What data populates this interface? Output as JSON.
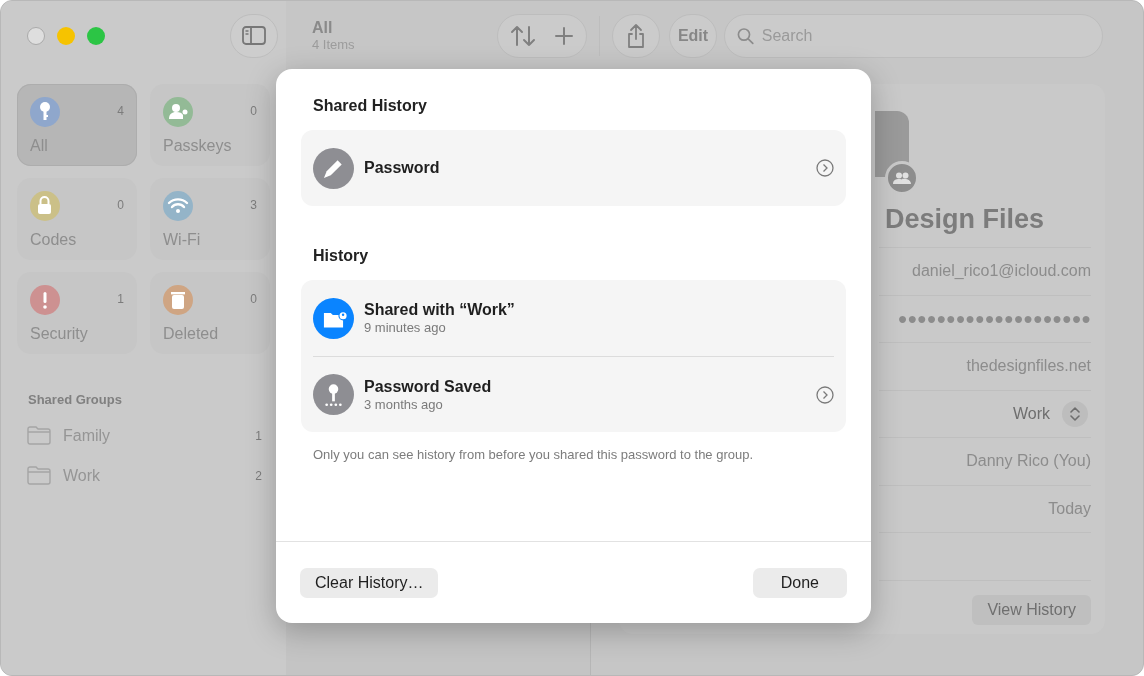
{
  "toolbar": {
    "title": "All",
    "subtitle": "4 Items",
    "edit_label": "Edit",
    "search": {
      "placeholder": "Search"
    }
  },
  "sidebar": {
    "tiles": [
      {
        "label": "All",
        "count": "4",
        "selected": true,
        "color": "#8fa7cc",
        "kind": "key"
      },
      {
        "label": "Passkeys",
        "count": "0",
        "selected": false,
        "color": "#93ba96",
        "kind": "person"
      },
      {
        "label": "Codes",
        "count": "0",
        "selected": false,
        "color": "#cbc088",
        "kind": "lock"
      },
      {
        "label": "Wi-Fi",
        "count": "3",
        "selected": false,
        "color": "#94b4c8",
        "kind": "wifi"
      },
      {
        "label": "Security",
        "count": "1",
        "selected": false,
        "color": "#cd9191",
        "kind": "alert"
      },
      {
        "label": "Deleted",
        "count": "0",
        "selected": false,
        "color": "#cfa583",
        "kind": "trash"
      }
    ],
    "section_title": "Shared Groups",
    "groups": [
      {
        "label": "Family",
        "count": "1"
      },
      {
        "label": "Work",
        "count": "2"
      }
    ]
  },
  "detail": {
    "title": "Design Files",
    "fields": [
      {
        "kind": "text",
        "value": "daniel_rico1@icloud.com"
      },
      {
        "kind": "text",
        "value": "●●●●●●●●●●●●●●●●●●●●"
      },
      {
        "kind": "text",
        "value": "thedesignfiles.net"
      },
      {
        "kind": "popup",
        "value": "Work"
      },
      {
        "kind": "text",
        "value": "Danny Rico (You)"
      },
      {
        "kind": "text",
        "value": "Today"
      },
      {
        "kind": "empty"
      }
    ],
    "button": "View History"
  },
  "dialog": {
    "sections": [
      {
        "title": "Shared History",
        "items": [
          {
            "title": "Password",
            "kind": "edit",
            "disclosure": true
          }
        ]
      },
      {
        "title": "History",
        "items": [
          {
            "title": "Shared with “Work”",
            "subtitle": "9 minutes ago",
            "kind": "share",
            "disclosure": false
          },
          {
            "title": "Password Saved",
            "subtitle": "3 months ago",
            "kind": "save",
            "disclosure": true
          }
        ]
      }
    ],
    "footnote": "Only you can see history from before you shared this password to the group.",
    "buttons": [
      {
        "label": "Clear History…",
        "kind": "secondary"
      },
      {
        "label": "Done",
        "kind": "default"
      }
    ]
  }
}
